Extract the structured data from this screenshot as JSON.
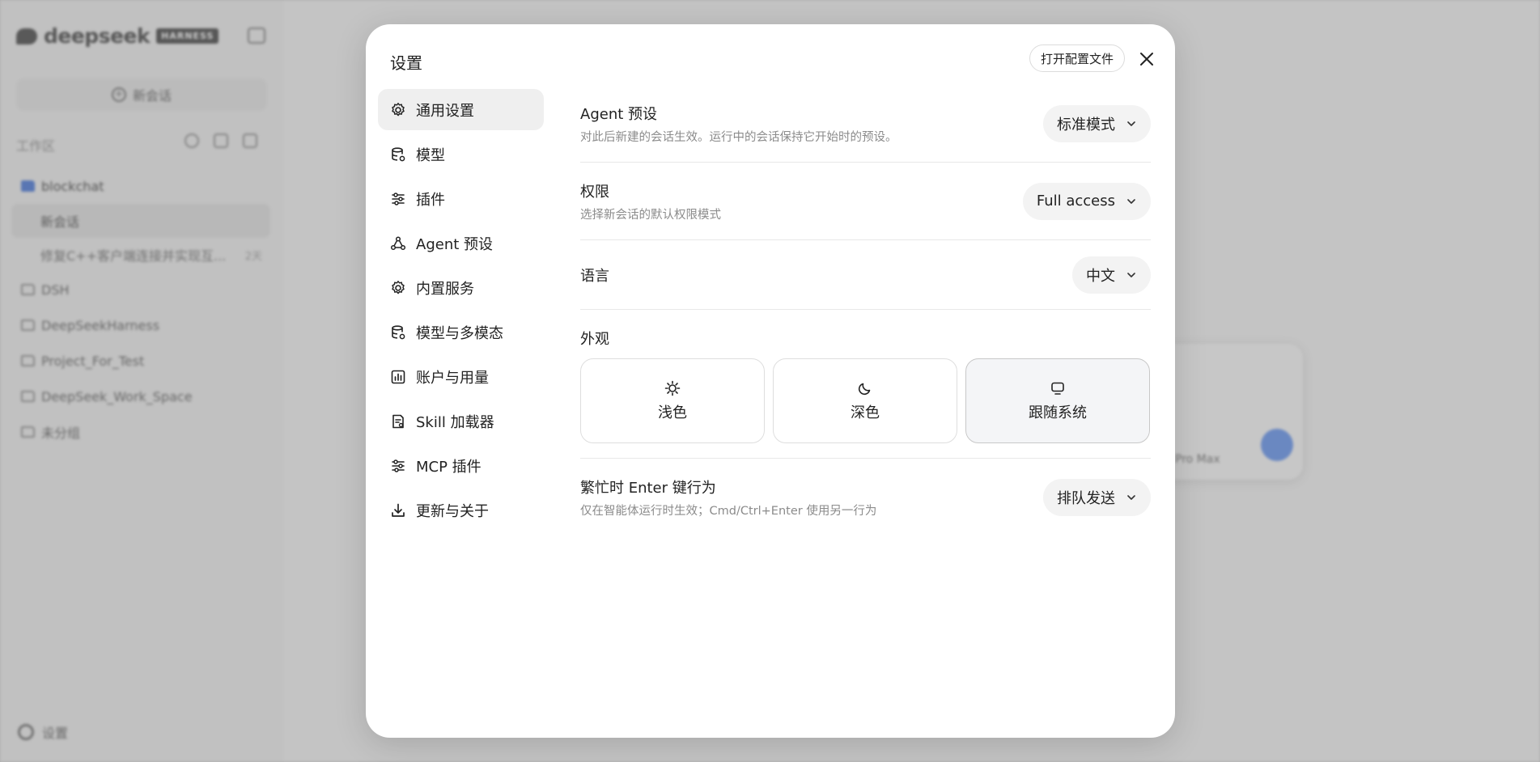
{
  "background": {
    "brand": {
      "name": "deepseek",
      "badge": "HARNESS"
    },
    "new_chat_label": "新会话",
    "workspace_label": "工作区",
    "tree": [
      {
        "type": "folder",
        "label": "blockchat",
        "highlight": true
      },
      {
        "type": "child",
        "label": "新会话",
        "active": true
      },
      {
        "type": "child",
        "label": "修复C++客户端连接并实现互...",
        "age": "2天"
      },
      {
        "type": "folder",
        "label": "DSH"
      },
      {
        "type": "folder",
        "label": "DeepSeekHarness"
      },
      {
        "type": "folder",
        "label": "Project_For_Test"
      },
      {
        "type": "folder",
        "label": "DeepSeek_Work_Space"
      },
      {
        "type": "folder",
        "label": "未分组"
      }
    ],
    "settings_label": "设置",
    "composer_model": "Pro Max"
  },
  "modal": {
    "title": "设置",
    "open_config_label": "打开配置文件",
    "close_icon": "close-icon",
    "nav": [
      {
        "id": "general",
        "label": "通用设置",
        "icon": "gear-icon",
        "active": true
      },
      {
        "id": "models",
        "label": "模型",
        "icon": "database-icon"
      },
      {
        "id": "plugins",
        "label": "插件",
        "icon": "sliders-icon"
      },
      {
        "id": "agent-presets",
        "label": "Agent 预设",
        "icon": "agent-icon"
      },
      {
        "id": "builtin-services",
        "label": "内置服务",
        "icon": "gear-icon"
      },
      {
        "id": "models-multimodal",
        "label": "模型与多模态",
        "icon": "database-icon"
      },
      {
        "id": "account-usage",
        "label": "账户与用量",
        "icon": "chart-icon"
      },
      {
        "id": "skill-loader",
        "label": "Skill 加载器",
        "icon": "document-icon"
      },
      {
        "id": "mcp-plugins",
        "label": "MCP 插件",
        "icon": "sliders-icon"
      },
      {
        "id": "update-about",
        "label": "更新与关于",
        "icon": "download-icon"
      }
    ],
    "settings": {
      "agent_preset": {
        "label": "Agent 预设",
        "desc": "对此后新建的会话生效。运行中的会话保持它开始时的预设。",
        "value": "标准模式"
      },
      "permission": {
        "label": "权限",
        "desc": "选择新会话的默认权限模式",
        "value": "Full access"
      },
      "language": {
        "label": "语言",
        "value": "中文"
      },
      "appearance": {
        "label": "外观",
        "options": [
          {
            "label": "浅色",
            "icon": "sun-icon"
          },
          {
            "label": "深色",
            "icon": "moon-icon"
          },
          {
            "label": "跟随系统",
            "icon": "monitor-icon",
            "selected": true
          }
        ]
      },
      "busy_enter": {
        "label": "繁忙时 Enter 键行为",
        "desc": "仅在智能体运行时生效；Cmd/Ctrl+Enter 使用另一行为",
        "value": "排队发送"
      }
    }
  }
}
